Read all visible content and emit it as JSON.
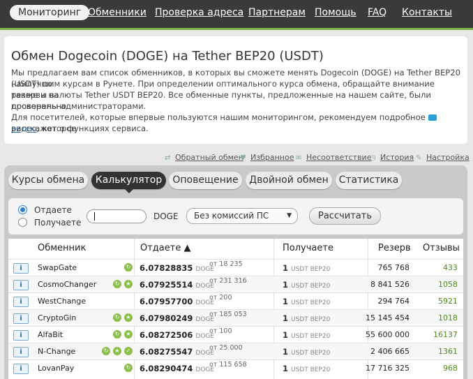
{
  "nav": [
    "Мониторинг",
    "Обменники",
    "Проверка адреса",
    "Партнерам",
    "Помощь",
    "FAQ",
    "Контакты"
  ],
  "intro": {
    "title": "Обмен Dogecoin (DOGE) на Tether BEP20 (USDT)",
    "p1": [
      "Мы предлагаем вам список обменников, в которых вы сможете менять Dogecoin (DOGE) на Tether BEP20 (USDT) по",
      "наилучшим курсам в Рунете. При определении оптимального курса обмена, обращайте внимание также и на",
      "резервы валюты Tether USDT BEP20. Все обменные пункты, предложенные на нашем сайте, были досконально",
      "проверены администраторами."
    ],
    "p2_before": "Для посетителей, которые впервые пользуются нашим мониторингом, рекомендуем подробное",
    "video_link": "видео",
    "p2_after": ", которое",
    "p2_line2": "расскажет о функциях сервиса."
  },
  "toolbar": [
    "Обратный обмен",
    "Избранное",
    "Несоответствие",
    "История",
    "Настройка"
  ],
  "tabs": [
    "Курсы обмена",
    "Калькулятор",
    "Оповещение",
    "Двойной обмен",
    "Статистика"
  ],
  "form": {
    "radio_give": "Отдаете",
    "radio_get": "Получаете",
    "amount_value": "",
    "currency": "DOGE",
    "commission": "Без комиссий ПС",
    "calc_button": "Рассчитать"
  },
  "table": {
    "headers": [
      "Обменник",
      "Отдаете ▲",
      "Получаете",
      "Резерв",
      "Отзывы"
    ],
    "give_unit": "DOGE",
    "get_unit": "USDT BEP20",
    "from_prefix": "от",
    "rows": [
      {
        "name": "SwapGate",
        "give": "6.07828835",
        "min": "18 235",
        "get": "1",
        "reserve": "765 768",
        "reviews": "433",
        "badges": 1
      },
      {
        "name": "CosmoChanger",
        "give": "6.07925514",
        "min": "231 316",
        "get": "1",
        "reserve": "8 841 526",
        "reviews": "1058",
        "badges": 2
      },
      {
        "name": "WestChange",
        "give": "6.07957700",
        "min": "200",
        "get": "1",
        "reserve": "294 764",
        "reviews": "5921",
        "badges": 0
      },
      {
        "name": "CryptoGin",
        "give": "6.07980249",
        "min": "185 053",
        "get": "1",
        "reserve": "15 145 454",
        "reviews": "1018",
        "badges": 2
      },
      {
        "name": "AlfaBit",
        "give": "6.08272506",
        "min": "100",
        "get": "1",
        "reserve": "55 600 000",
        "reviews": "16137",
        "badges": 2
      },
      {
        "name": "N-Change",
        "give": "6.08275547",
        "min": "25 000",
        "get": "1",
        "reserve": "2 406 665",
        "reviews": "1361",
        "badges": 3
      },
      {
        "name": "LovanPay",
        "give": "6.08290474",
        "min": "115 658",
        "get": "1",
        "reserve": "17 716 325",
        "reviews": "968",
        "badges": 1
      }
    ]
  },
  "colors": {
    "accent_green": "#7cb342",
    "nav_bg": "#3a3a3a",
    "link_blue": "#2a6fb0"
  }
}
